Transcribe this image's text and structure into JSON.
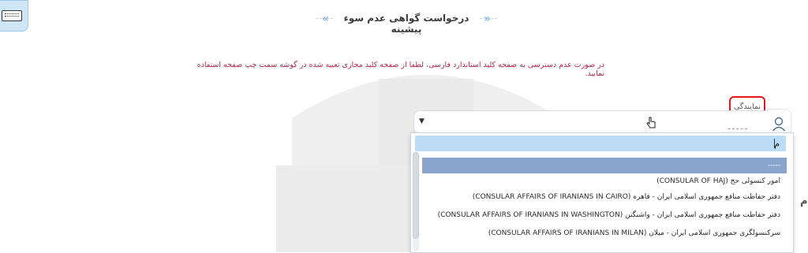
{
  "header": {
    "title": "درخواست گواهی عدم سوء پیشینه"
  },
  "notice": {
    "text": "در صورت عدم دسترسی به صفحه کلید استاندارد فارسی، لطفا از صفحه کلید مجازی تعبیه شده در گوشه سمت چپ صفحه استفاده نمایید."
  },
  "representation": {
    "label": "نمایندگی",
    "placeholder_dashes": "-----",
    "search": {
      "value": "م"
    },
    "options": [
      {
        "label": "-----",
        "selected": true
      },
      {
        "label": "امور کنسولی حج (CONSULAR OF HAJ)"
      },
      {
        "label": "دفتر حفاظت منافع جمهوری اسلامی ایران - قاهره (CONSULAR AFFAIRS OF IRANIANS IN CAIRO)"
      },
      {
        "label": "دفتر حفاظت منافع جمهوری اسلامی ایران - واشنگتن (CONSULAR AFFAIRS OF IRANIANS IN WASHINGTON)"
      },
      {
        "label": "سرکنسولگری جمهوری اسلامی ایران - میلان (CONSULAR AFFAIRS OF IRANIANS IN MILAN)"
      }
    ]
  },
  "icons": {
    "keyboard": "keyboard-icon",
    "person": "person-icon",
    "dropdown_arrow": "caret-down-icon",
    "cursor": "hand-cursor-icon"
  },
  "colors": {
    "accent_blue": "#bcdcf5",
    "selected_option": "#8aa5cb",
    "notice_red": "#b0284d",
    "highlight_red": "#e0181f"
  },
  "side_fragment": "م"
}
